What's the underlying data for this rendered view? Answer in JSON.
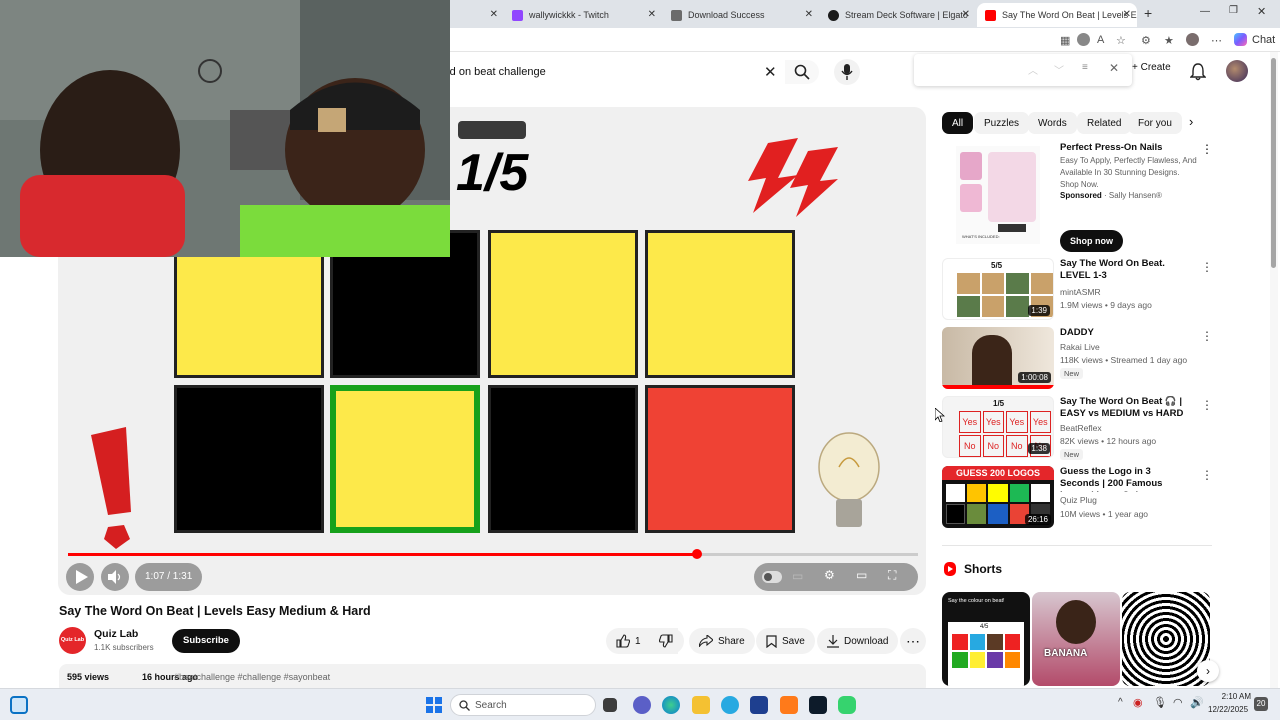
{
  "browser": {
    "tabs": [
      {
        "label": "wallywickkk - Twitch",
        "icon_color": "#9146ff"
      },
      {
        "label": "Download Success",
        "icon_color": "#6b6b6b"
      },
      {
        "label": "Stream Deck Software | Elgato",
        "icon_color": "#1b1b1b"
      },
      {
        "label": "Say The Word On Beat | Levels Eas",
        "icon_color": "#ff0000",
        "active": true
      }
    ],
    "new_tab": "+",
    "chat_label": "Chat"
  },
  "youtube": {
    "search_value": "rd on beat challenge",
    "create_label": "Create"
  },
  "player": {
    "level_text": "1/5",
    "time": "1:07 / 1:31",
    "progress": 0.74
  },
  "video": {
    "title": "Say The Word On Beat | Levels Easy Medium & Hard",
    "channel": "Quiz Lab",
    "channel_avatar": "Quiz Lab",
    "subscribers": "1.1K subscribers",
    "subscribe_label": "Subscribe",
    "likes": "1",
    "share_label": "Share",
    "save_label": "Save",
    "download_label": "Download",
    "views": "595 views",
    "age": "16 hours ago",
    "hashtags": "#beatchallenge #challenge #sayonbeat"
  },
  "chips": [
    "All",
    "Puzzles",
    "Words",
    "Related",
    "For you"
  ],
  "sponsored": {
    "title": "Perfect Press-On Nails",
    "desc": "Easy To Apply, Perfectly Flawless, And Available In 30 Stunning Designs. Shop Now.",
    "sponsored_label": "Sponsored",
    "advertiser": "Sally Hansen®",
    "cta": "Shop now",
    "thumb_caption": "WHAT'S INCLUDED:"
  },
  "recommendations": [
    {
      "title": "Say The Word On Beat. LEVEL 1-3",
      "channel": "mintASMR",
      "meta": "1.9M views • 9 days ago",
      "duration": "1:39",
      "new": "",
      "thumb_text": "5/5"
    },
    {
      "title": "DADDY",
      "channel": "Rakai Live",
      "meta": "118K views • Streamed 1 day ago",
      "duration": "1:00:08",
      "new": "New",
      "thumb_text": ""
    },
    {
      "title": "Say The Word On Beat 🎧 | EASY vs MEDIUM vs HARD ...",
      "channel": "BeatReflex",
      "meta": "82K views • 12 hours ago",
      "duration": "1:38",
      "new": "New",
      "thumb_text": "1/5"
    },
    {
      "title": "Guess the Logo in 3 Seconds | 200 Famous Logos | Logo Qui...",
      "channel": "Quiz Plug",
      "meta": "10M views • 1 year ago",
      "duration": "26:16",
      "new": "",
      "thumb_text": "GUESS 200 LOGOS"
    }
  ],
  "thumb_words": {
    "yes": "Yes",
    "no": "No"
  },
  "shorts": {
    "heading": "Shorts",
    "items": [
      {
        "caption": "Say the colour on beat!",
        "sub": "4/5"
      },
      {
        "caption": "BANANA",
        "sub": ""
      },
      {
        "caption": "",
        "sub": ""
      }
    ]
  },
  "taskbar": {
    "search_placeholder": "Search",
    "time": "2:10 AM",
    "date": "12/22/2025",
    "badge": "20"
  }
}
